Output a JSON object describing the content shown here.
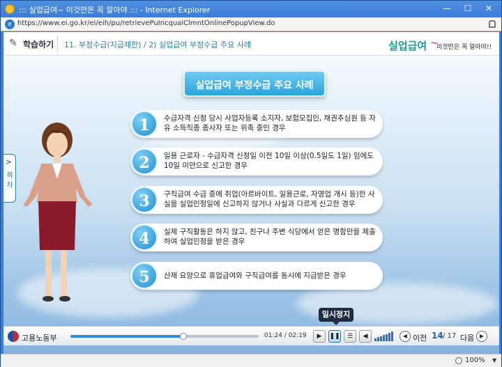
{
  "window": {
    "title": "::: 실업급여~ 이것만은 꼭 알아야 ::: - Internet Explorer",
    "min_glyph": "—",
    "max_glyph": "☐",
    "close_glyph": "✕",
    "address": "https://www.ei.go.kr/ei/eih/pu/retrievePuIncqualClmntOnlinePopupView.do",
    "zoom": "100%"
  },
  "header": {
    "learn_label": "학습하기",
    "breadcrumb": "11. 부정수급(지급제한) / 2) 실업급여 부정수급 주요 사례",
    "brand_main": "실업급여",
    "brand_tilde": "~",
    "brand_sub": "이것만은 꼭 알아야!!"
  },
  "toc": {
    "arrow": ">",
    "label": "목차"
  },
  "banner": "실업급여 부정수급 주요 사례",
  "items": [
    {
      "num": "1",
      "text": "수급자격 신청 당시 사업자등록 소지자, 보험모집인, 채권추심원 등 자유 소득직종 종사자 또는 위촉 중인 경우"
    },
    {
      "num": "2",
      "text": "일용 근로자 - 수급자격 신청일 이전 10일 이상(0.5일도 1일) 임에도 10일 미만으로 신고한 경우"
    },
    {
      "num": "3",
      "text": "구직급여 수급 중에 취업(아르바이트, 일용근로, 자영업 개시 등)한 사실을 실업인정일에 신고하지 않거나 사실과 다르게 신고한 경우"
    },
    {
      "num": "4",
      "text": "실제 구직활동은 하지 않고, 친구나 주변 식당에서 얻은 명함만을 제출하여 실업인정을 받은 경우"
    },
    {
      "num": "5",
      "text": "산재 요양으로 휴업급여와 구직급여를 동시에 지급받은 경우"
    }
  ],
  "player": {
    "ministry": "고용노동부",
    "time_current": "01:24",
    "time_total": "/ 02:19",
    "progress": 0.6,
    "volume_level": 1.0,
    "pause_tooltip": "일시정지",
    "play_glyph": "▶",
    "pause_glyph": "❚❚",
    "list_glyph": "☰",
    "volume_glyph": "◀",
    "prev_glyph": "◀",
    "next_glyph": "▶",
    "prev_label": "이전",
    "next_label": "다음",
    "page_current": "14",
    "page_total": "/ 17"
  }
}
